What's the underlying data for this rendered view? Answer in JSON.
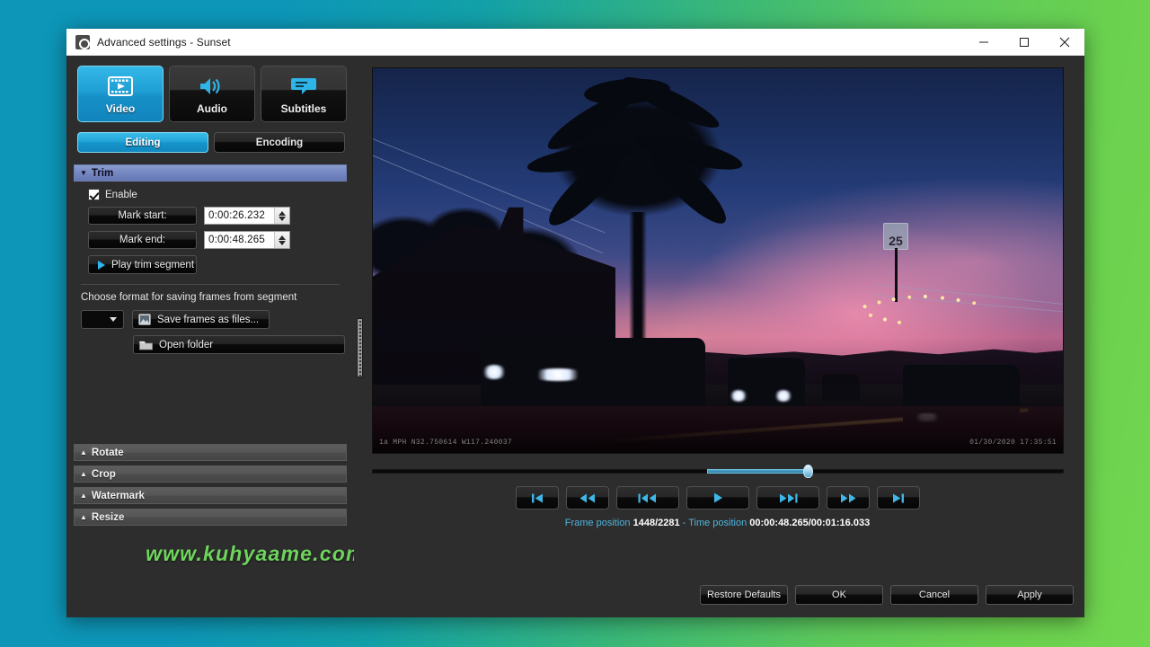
{
  "window": {
    "title": "Advanced settings - Sunset",
    "app_icon": "app-settings-icon",
    "controls": {
      "minimize": "minimize-icon",
      "maximize": "maximize-icon",
      "close": "close-icon"
    }
  },
  "sidebar": {
    "media_tabs": [
      {
        "label": "Video",
        "icon": "film-strip-icon",
        "active": true
      },
      {
        "label": "Audio",
        "icon": "speaker-icon",
        "active": false
      },
      {
        "label": "Subtitles",
        "icon": "subtitle-bubble-icon",
        "active": false
      }
    ],
    "sub_tabs": [
      {
        "label": "Editing",
        "active": true
      },
      {
        "label": "Encoding",
        "active": false
      }
    ],
    "trim": {
      "header": "Trim",
      "header_arrow": "▼",
      "enable_label": "Enable",
      "enable_checked": true,
      "mark_start_label": "Mark start:",
      "mark_start_value": "0:00:26.232",
      "mark_end_label": "Mark end:",
      "mark_end_value": "0:00:48.265",
      "play_trim_label": "Play trim segment",
      "format_hint": "Choose format for saving frames from segment",
      "format_value": "",
      "save_frames_label": "Save frames as files...",
      "open_folder_label": "Open folder"
    },
    "collapsed_sections": [
      {
        "label": "Rotate",
        "arrow": "▲"
      },
      {
        "label": "Crop",
        "arrow": "▲"
      },
      {
        "label": "Watermark",
        "arrow": "▲"
      },
      {
        "label": "Resize",
        "arrow": "▲"
      }
    ],
    "watermark_text": "www.kuhyaame.com"
  },
  "preview": {
    "overlay_left": "1a MPH N32.750614 W117.240037",
    "overlay_right": "01/30/2020 17:35:51",
    "seek": {
      "fill_start_percent": 48.5,
      "fill_end_percent": 63,
      "handle_percent": 63
    },
    "transport_buttons": [
      {
        "name": "go-to-start-button",
        "glyph": "start"
      },
      {
        "name": "rewind-button",
        "glyph": "rewind"
      },
      {
        "name": "previous-frame-button",
        "glyph": "prev-frame"
      },
      {
        "name": "play-button",
        "glyph": "play"
      },
      {
        "name": "next-frame-button",
        "glyph": "next-frame"
      },
      {
        "name": "fast-forward-button",
        "glyph": "forward"
      },
      {
        "name": "go-to-end-button",
        "glyph": "end"
      }
    ],
    "status": {
      "frame_label": "Frame position",
      "frame_value": "1448/2281",
      "separator": "-",
      "time_label": "Time position",
      "time_value": "00:00:48.265/00:01:16.033"
    }
  },
  "footer": {
    "buttons": [
      "Restore Defaults",
      "OK",
      "Cancel",
      "Apply"
    ]
  },
  "colors": {
    "accent_blue": "#1f9fd4",
    "group_header": "#7587c2",
    "status_label": "#4fb4dd",
    "watermark_green": "#6ed45c",
    "desktop_left": "#0d96b8",
    "desktop_right": "#6ad14f"
  }
}
